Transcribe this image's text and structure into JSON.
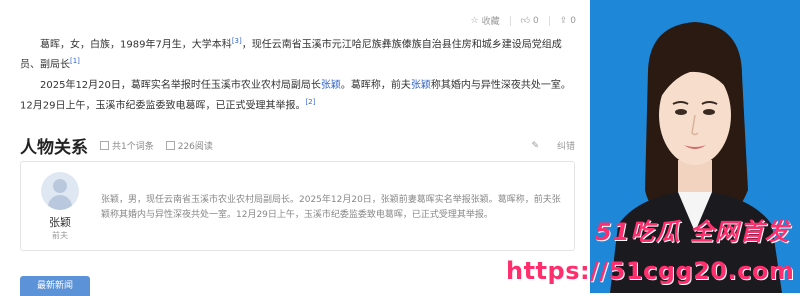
{
  "toolbar": {
    "favorite_label": "收藏",
    "like_count": "0",
    "share_count": "0"
  },
  "intro": {
    "p1_text": "葛晖，女，白族，1989年7月生，大学本科",
    "p1_ref1": "[3]",
    "p1_text2": "，现任云南省玉溪市元江哈尼族彝族傣族自治县住房和城乡建设局党组成员、副局长",
    "p1_ref2": "[1]",
    "p2_text": "2025年12月20日，葛晖实名举报时任玉溪市农业农村局副局长",
    "p2_link1": "张颖",
    "p2_text2": "。葛晖称，前夫",
    "p2_link2": "张颖",
    "p2_text3": "称其婚内与异性深夜共处一室。12月29日上午，玉溪市纪委监委致电葛晖，已正式受理其举报。",
    "p2_ref": "[2]"
  },
  "relations": {
    "title": "人物关系",
    "entry_count": "共1个词条",
    "read_count": "226阅读",
    "correction_label": "纠错",
    "person": {
      "name": "张颖",
      "relation": "前夫",
      "description": "张颖，男，现任云南省玉溪市农业农村局副局长。2025年12月20日，张颖前妻葛晖实名举报张颖。葛晖称，前夫张颖称其婚内与异性深夜共处一室。12月29日上午，玉溪市纪委监委致电葛晖，已正式受理其举报。"
    }
  },
  "news_tab": "最新新闻",
  "watermark": {
    "line1": "51吃瓜 全网首发",
    "line2": "https://51cgg20.com"
  },
  "colors": {
    "link": "#3366cc",
    "photo_bg": "#1e87d8",
    "watermark": "#ff2f6e"
  }
}
